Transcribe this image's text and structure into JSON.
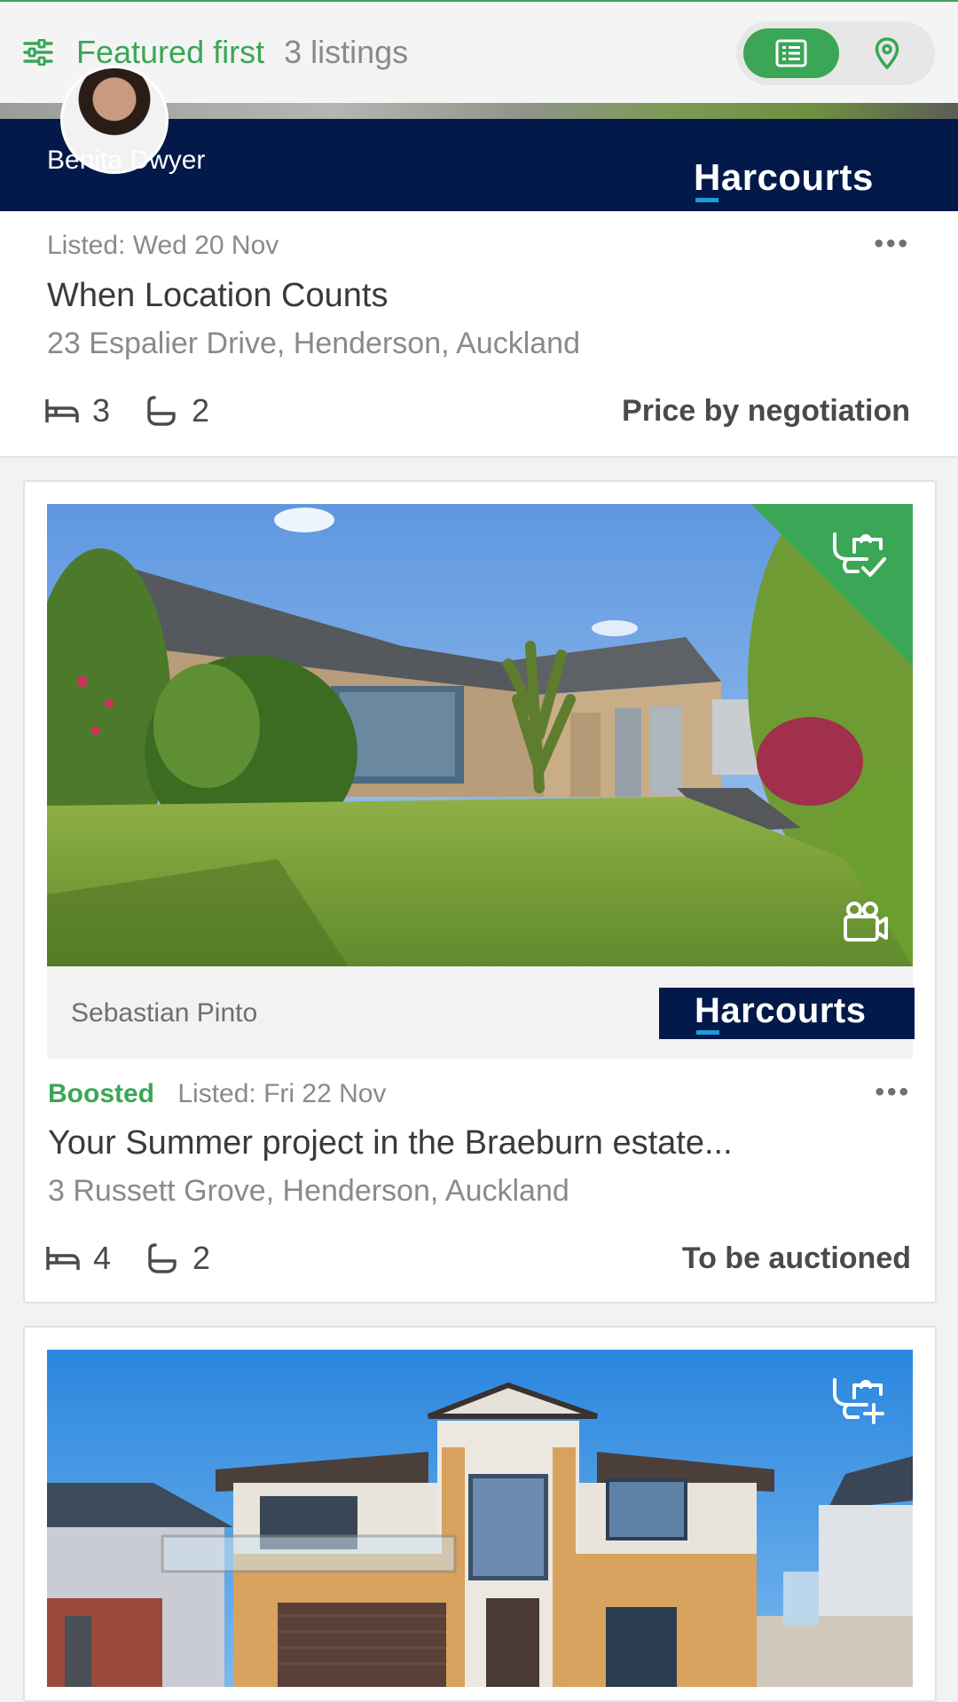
{
  "topbar": {
    "sort_label": "Featured first",
    "count_label": "3 listings",
    "view_list_icon": "list-icon",
    "view_map_icon": "map-pin-icon"
  },
  "colors": {
    "accent_green": "#3aa656",
    "harcourts_navy": "#02194a",
    "harcourts_blue": "#1e9bde"
  },
  "listings": [
    {
      "agent": "Benita Dwyer",
      "agency": "Harcourts",
      "boosted": "",
      "listed": "Listed: Wed 20 Nov",
      "title": "When Location Counts",
      "address": "23 Espalier Drive, Henderson, Auckland",
      "beds": "3",
      "baths": "2",
      "price": "Price by negotiation"
    },
    {
      "agent": "Sebastian Pinto",
      "agency": "Harcourts",
      "boosted": "Boosted",
      "listed": "Listed: Fri 22 Nov",
      "title": "Your Summer project in the Braeburn estate...",
      "address": "3 Russett Grove, Henderson, Auckland",
      "beds": "4",
      "baths": "2",
      "price": "To be auctioned",
      "badge_icon": "watchlist-checked-icon",
      "media_icon": "video-camera-icon"
    },
    {
      "badge_icon": "watchlist-add-icon"
    }
  ],
  "more_icon": "more-options-icon"
}
